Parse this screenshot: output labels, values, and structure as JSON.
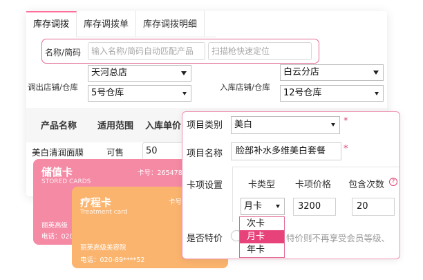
{
  "tabs": [
    {
      "label": "库存调拨"
    },
    {
      "label": "库存调拨单"
    },
    {
      "label": "库存调拨明细"
    }
  ],
  "search": {
    "label": "名称/简码",
    "name_placeholder": "输入名称/简码自动匹配产品",
    "scan_placeholder": "扫描枪快速定位"
  },
  "transfer": {
    "out_label": "调出店铺/仓库",
    "out_store": "天河总店",
    "out_warehouse": "5号仓库",
    "in_label": "入库店铺/仓库",
    "in_store": "白云分店",
    "in_warehouse": "12号仓库"
  },
  "table": {
    "headers": [
      "产品名称",
      "适用范围",
      "入库单价"
    ],
    "rows": [
      {
        "name": "美白清润面膜",
        "scope": "可售",
        "price": "50"
      }
    ]
  },
  "cards": [
    {
      "title": "储值卡",
      "subtitle": "STORED CARDS",
      "number": "卡号：265478",
      "shop": "丽英高级",
      "phone": "电话：020"
    },
    {
      "title": "疗程卡",
      "subtitle": "Treatment card",
      "number": "卡号",
      "shop": "丽英高级美容院",
      "phone": "电话：020-89****52"
    }
  ],
  "dialog": {
    "category_label": "项目类别",
    "category_value": "美白",
    "name_label": "项目名称",
    "name_value": "脸部补水多维美白套餐",
    "required_mark": "*",
    "card_settings_label": "卡项设置",
    "col_type": "卡类型",
    "col_price": "卡项价格",
    "col_count": "包含次数",
    "help_mark": "?",
    "card_type_value": "月卡",
    "card_price_value": "3200",
    "card_count_value": "20",
    "special_label": "是否特价",
    "special_note": "特价则不再享受会员等级、",
    "options": [
      "次卡",
      "月卡",
      "年卡"
    ],
    "selected_option": "月卡"
  },
  "colors": {
    "accent": "#e8427a",
    "pink_card": "#f58aa5",
    "orange_card": "#fbb46e"
  }
}
